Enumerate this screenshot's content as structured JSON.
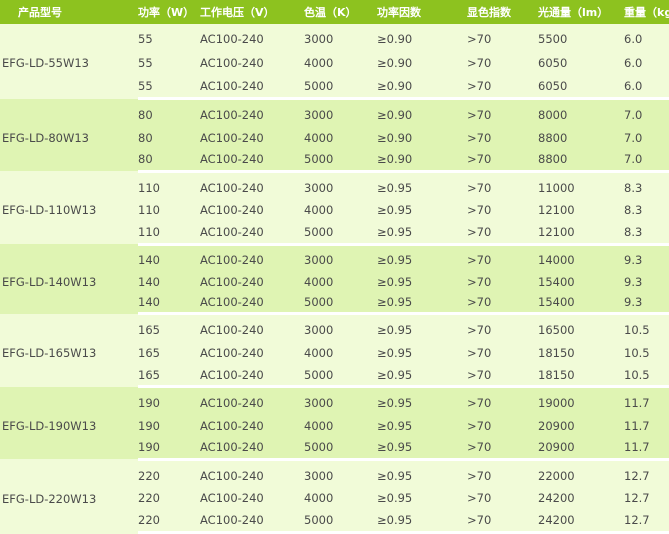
{
  "headers": [
    "产品型号",
    "功率（W）",
    "工作电压（V）",
    "色温（K）",
    "功率因数",
    "显色指数",
    "光通量（lm）",
    "重量（kg）"
  ],
  "groups": [
    {
      "model": "EFG-LD-55W13",
      "rows": [
        [
          "55",
          "AC100-240",
          "3000",
          "≥0.90",
          ">70",
          "5500",
          "6.0"
        ],
        [
          "55",
          "AC100-240",
          "4000",
          "≥0.90",
          ">70",
          "6050",
          "6.0"
        ],
        [
          "55",
          "AC100-240",
          "5000",
          "≥0.90",
          ">70",
          "6050",
          "6.0"
        ]
      ]
    },
    {
      "model": "EFG-LD-80W13",
      "rows": [
        [
          "80",
          "AC100-240",
          "3000",
          "≥0.90",
          ">70",
          "8000",
          "7.0"
        ],
        [
          "80",
          "AC100-240",
          "4000",
          "≥0.90",
          ">70",
          "8800",
          "7.0"
        ],
        [
          "80",
          "AC100-240",
          "5000",
          "≥0.90",
          ">70",
          "8800",
          "7.0"
        ]
      ]
    },
    {
      "model": "EFG-LD-110W13",
      "rows": [
        [
          "110",
          "AC100-240",
          "3000",
          "≥0.95",
          ">70",
          "11000",
          "8.3"
        ],
        [
          "110",
          "AC100-240",
          "4000",
          "≥0.95",
          ">70",
          "12100",
          "8.3"
        ],
        [
          "110",
          "AC100-240",
          "5000",
          "≥0.95",
          ">70",
          "12100",
          "8.3"
        ]
      ]
    },
    {
      "model": "EFG-LD-140W13",
      "rows": [
        [
          "140",
          "AC100-240",
          "3000",
          "≥0.95",
          ">70",
          "14000",
          "9.3"
        ],
        [
          "140",
          "AC100-240",
          "4000",
          "≥0.95",
          ">70",
          "15400",
          "9.3"
        ],
        [
          "140",
          "AC100-240",
          "5000",
          "≥0.95",
          ">70",
          "15400",
          "9.3"
        ]
      ]
    },
    {
      "model": "EFG-LD-165W13",
      "rows": [
        [
          "165",
          "AC100-240",
          "3000",
          "≥0.95",
          ">70",
          "16500",
          "10.5"
        ],
        [
          "165",
          "AC100-240",
          "4000",
          "≥0.95",
          ">70",
          "18150",
          "10.5"
        ],
        [
          "165",
          "AC100-240",
          "5000",
          "≥0.95",
          ">70",
          "18150",
          "10.5"
        ]
      ]
    },
    {
      "model": "EFG-LD-190W13",
      "rows": [
        [
          "190",
          "AC100-240",
          "3000",
          "≥0.95",
          ">70",
          "19000",
          "11.7"
        ],
        [
          "190",
          "AC100-240",
          "4000",
          "≥0.95",
          ">70",
          "20900",
          "11.7"
        ],
        [
          "190",
          "AC100-240",
          "5000",
          "≥0.95",
          ">70",
          "20900",
          "11.7"
        ]
      ]
    },
    {
      "model": "EFG-LD-220W13",
      "rows": [
        [
          "220",
          "AC100-240",
          "3000",
          "≥0.95",
          ">70",
          "22000",
          "12.7"
        ],
        [
          "220",
          "AC100-240",
          "4000",
          "≥0.95",
          ">70",
          "24200",
          "12.7"
        ],
        [
          "220",
          "AC100-240",
          "5000",
          "≥0.95",
          ">70",
          "24200",
          "12.7"
        ]
      ]
    }
  ]
}
